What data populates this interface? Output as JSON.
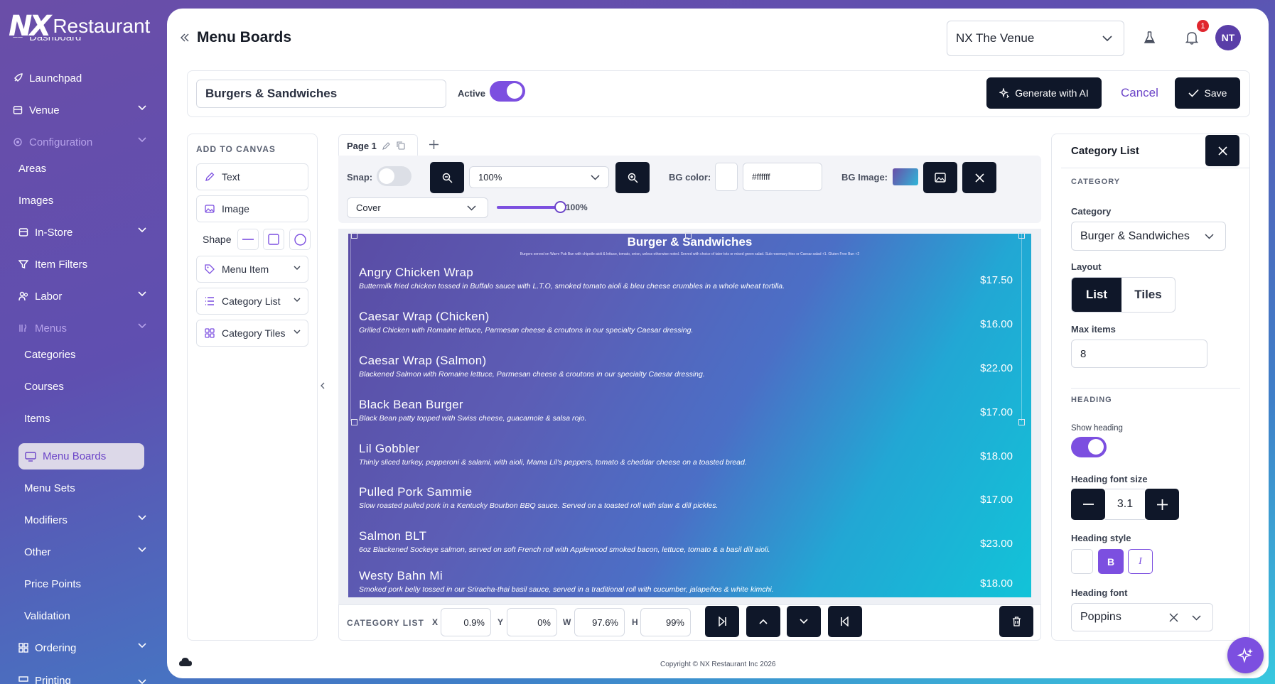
{
  "brand": {
    "logo_mark": "NX",
    "logo_text": "Restaurant"
  },
  "sidebar": {
    "items": [
      {
        "label": "Dashboard",
        "icon": "grid-icon"
      },
      {
        "label": "Launchpad",
        "icon": "rocket-icon"
      },
      {
        "label": "Venue",
        "icon": "store-icon",
        "has_children": true
      },
      {
        "label": "Configuration",
        "icon": "gear-icon",
        "has_children": true,
        "expanded": true
      },
      {
        "label": "Areas"
      },
      {
        "label": "Images"
      },
      {
        "label": "In-Store",
        "icon": "store-icon",
        "has_children": true
      },
      {
        "label": "Item Filters",
        "icon": "filter-icon"
      },
      {
        "label": "Labor",
        "icon": "people-icon",
        "has_children": true
      },
      {
        "label": "Menus",
        "icon": "menu-icon",
        "has_children": true,
        "expanded": true
      },
      {
        "label": "Categories"
      },
      {
        "label": "Courses"
      },
      {
        "label": "Items"
      },
      {
        "label": "Menu Boards",
        "icon": "monitor-icon",
        "active": true
      },
      {
        "label": "Menu Sets"
      },
      {
        "label": "Modifiers",
        "has_children": true
      },
      {
        "label": "Other",
        "has_children": true
      },
      {
        "label": "Price Points"
      },
      {
        "label": "Validation"
      },
      {
        "label": "Ordering",
        "icon": "cart-icon",
        "has_children": true
      },
      {
        "label": "Printing",
        "icon": "printer-icon",
        "has_children": true
      }
    ]
  },
  "header": {
    "title": "Menu Boards",
    "venue_select": "NX The Venue",
    "notification_count": "1",
    "avatar_initials": "NT"
  },
  "board_bar": {
    "name_value": "Burgers & Sandwiches",
    "active_label": "Active",
    "active_on": true,
    "generate_label": "Generate with AI",
    "cancel_label": "Cancel",
    "save_label": "Save"
  },
  "add_panel": {
    "heading": "ADD TO CANVAS",
    "text_label": "Text",
    "image_label": "Image",
    "shape_label": "Shape",
    "menu_item_label": "Menu Item",
    "category_list_label": "Category List",
    "category_tiles_label": "Category Tiles"
  },
  "toolbar": {
    "page_tab": "Page 1",
    "snap_label": "Snap:",
    "snap_on": false,
    "zoom_value": "100%",
    "bg_color_label": "BG color:",
    "bg_color_value": "#ffffff",
    "bg_image_label": "BG Image:",
    "fit_value": "Cover",
    "opacity_value": "100%",
    "opacity_fraction": 1.0
  },
  "board": {
    "title": "Burger & Sandwiches",
    "subtitle": "Burgers served on Warm Pub Bun with chipotle aioli & lettuce, tomato, onion, unless otherwise noted. Served with choice of tater tots or mixed green salad. Sub rosemary fries or Caesar salad +1. Gluten Free Bun +2",
    "items": [
      {
        "name": "Angry Chicken Wrap",
        "desc": "Buttermilk fried chicken tossed in Buffalo sauce with L.T.O, smoked tomato aioli & bleu cheese crumbles in a whole wheat tortilla.",
        "price": "$17.50"
      },
      {
        "name": "Caesar Wrap (Chicken)",
        "desc": "Grilled Chicken with Romaine lettuce, Parmesan cheese & croutons in our specialty Caesar dressing.",
        "price": "$16.00"
      },
      {
        "name": "Caesar Wrap (Salmon)",
        "desc": "Blackened Salmon with Romaine lettuce, Parmesan cheese & croutons in our specialty Caesar dressing.",
        "price": "$22.00"
      },
      {
        "name": "Black Bean Burger",
        "desc": "Black Bean patty topped with Swiss cheese, guacamole & salsa rojo.",
        "price": "$17.00"
      },
      {
        "name": "Lil Gobbler",
        "desc": "Thinly sliced turkey, pepperoni & salami, with aioli, Mama Lil's peppers, tomato & cheddar cheese on a toasted bread.",
        "price": "$18.00"
      },
      {
        "name": "Pulled Pork Sammie",
        "desc": "Slow roasted pulled pork in a Kentucky Bourbon BBQ sauce. Served on a toasted roll with slaw & dill pickles.",
        "price": "$17.00"
      },
      {
        "name": "Salmon BLT",
        "desc": "6oz Blackened Sockeye salmon, served on soft French roll with Applewood smoked bacon, lettuce, tomato & a basil dill aioli.",
        "price": "$23.00"
      },
      {
        "name": "Westy Bahn Mi",
        "desc": "Smoked pork belly tossed in our Sriracha-thai basil sauce, served in a traditional roll with cucumber, jalapeños & white kimchi.",
        "price": "$18.00"
      }
    ]
  },
  "position_bar": {
    "label": "CATEGORY LIST",
    "x_label": "X",
    "x_value": "0.9%",
    "y_label": "Y",
    "y_value": "0%",
    "w_label": "W",
    "w_value": "97.6%",
    "h_label": "H",
    "h_value": "99%"
  },
  "props": {
    "title": "Category List",
    "category_section": "CATEGORY",
    "category_label": "Category",
    "category_value": "Burger & Sandwiches",
    "layout_label": "Layout",
    "layout_list": "List",
    "layout_tiles": "Tiles",
    "max_items_label": "Max items",
    "max_items_value": "8",
    "heading_section": "HEADING",
    "show_heading_label": "Show heading",
    "show_heading_on": true,
    "heading_size_label": "Heading font size",
    "heading_size_value": "3.1",
    "heading_style_label": "Heading style",
    "bold_label": "B",
    "italic_label": "I",
    "heading_font_label": "Heading font",
    "heading_font_value": "Poppins"
  },
  "footer": {
    "copyright": "Copyright © NX Restaurant Inc 2026"
  },
  "colors": {
    "accent": "#7c4fe0",
    "dark": "#0f1729",
    "link": "#6c45c8"
  }
}
